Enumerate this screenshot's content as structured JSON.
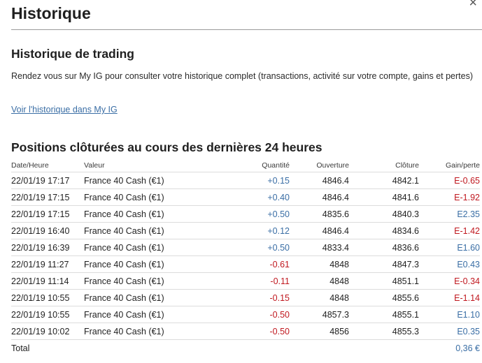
{
  "header": {
    "title": "Historique",
    "close_glyph": "×"
  },
  "history": {
    "title": "Historique de trading",
    "description": "Rendez vous sur My IG pour consulter votre historique complet (transactions, activité sur votre compte, gains et pertes)",
    "link_label": "Voir l'historique dans My IG"
  },
  "positions": {
    "title": "Positions clôturées au cours des dernières 24 heures",
    "columns": [
      "Date/Heure",
      "Valeur",
      "Quantité",
      "Ouverture",
      "Clôture",
      "Gain/perte"
    ],
    "rows": [
      {
        "date": "22/01/19 17:17",
        "value": "France 40 Cash (€1)",
        "qty": "+0.15",
        "open": "4846.4",
        "close": "4842.1",
        "gain": "E-0.65"
      },
      {
        "date": "22/01/19 17:15",
        "value": "France 40 Cash (€1)",
        "qty": "+0.40",
        "open": "4846.4",
        "close": "4841.6",
        "gain": "E-1.92"
      },
      {
        "date": "22/01/19 17:15",
        "value": "France 40 Cash (€1)",
        "qty": "+0.50",
        "open": "4835.6",
        "close": "4840.3",
        "gain": "E2.35"
      },
      {
        "date": "22/01/19 16:40",
        "value": "France 40 Cash (€1)",
        "qty": "+0.12",
        "open": "4846.4",
        "close": "4834.6",
        "gain": "E-1.42"
      },
      {
        "date": "22/01/19 16:39",
        "value": "France 40 Cash (€1)",
        "qty": "+0.50",
        "open": "4833.4",
        "close": "4836.6",
        "gain": "E1.60"
      },
      {
        "date": "22/01/19 11:27",
        "value": "France 40 Cash (€1)",
        "qty": "-0.61",
        "open": "4848",
        "close": "4847.3",
        "gain": "E0.43"
      },
      {
        "date": "22/01/19 11:14",
        "value": "France 40 Cash (€1)",
        "qty": "-0.11",
        "open": "4848",
        "close": "4851.1",
        "gain": "E-0.34"
      },
      {
        "date": "22/01/19 10:55",
        "value": "France 40 Cash (€1)",
        "qty": "-0.15",
        "open": "4848",
        "close": "4855.6",
        "gain": "E-1.14"
      },
      {
        "date": "22/01/19 10:55",
        "value": "France 40 Cash (€1)",
        "qty": "-0.50",
        "open": "4857.3",
        "close": "4855.1",
        "gain": "E1.10"
      },
      {
        "date": "22/01/19 10:02",
        "value": "France 40 Cash (€1)",
        "qty": "-0.50",
        "open": "4856",
        "close": "4855.3",
        "gain": "E0.35"
      }
    ],
    "total_label": "Total",
    "total_value": "0,36 €"
  },
  "colors": {
    "positive": "#3a6ea5",
    "negative": "#c0181f",
    "link": "#3a6ea5"
  },
  "icons": {
    "close": "close-icon"
  }
}
